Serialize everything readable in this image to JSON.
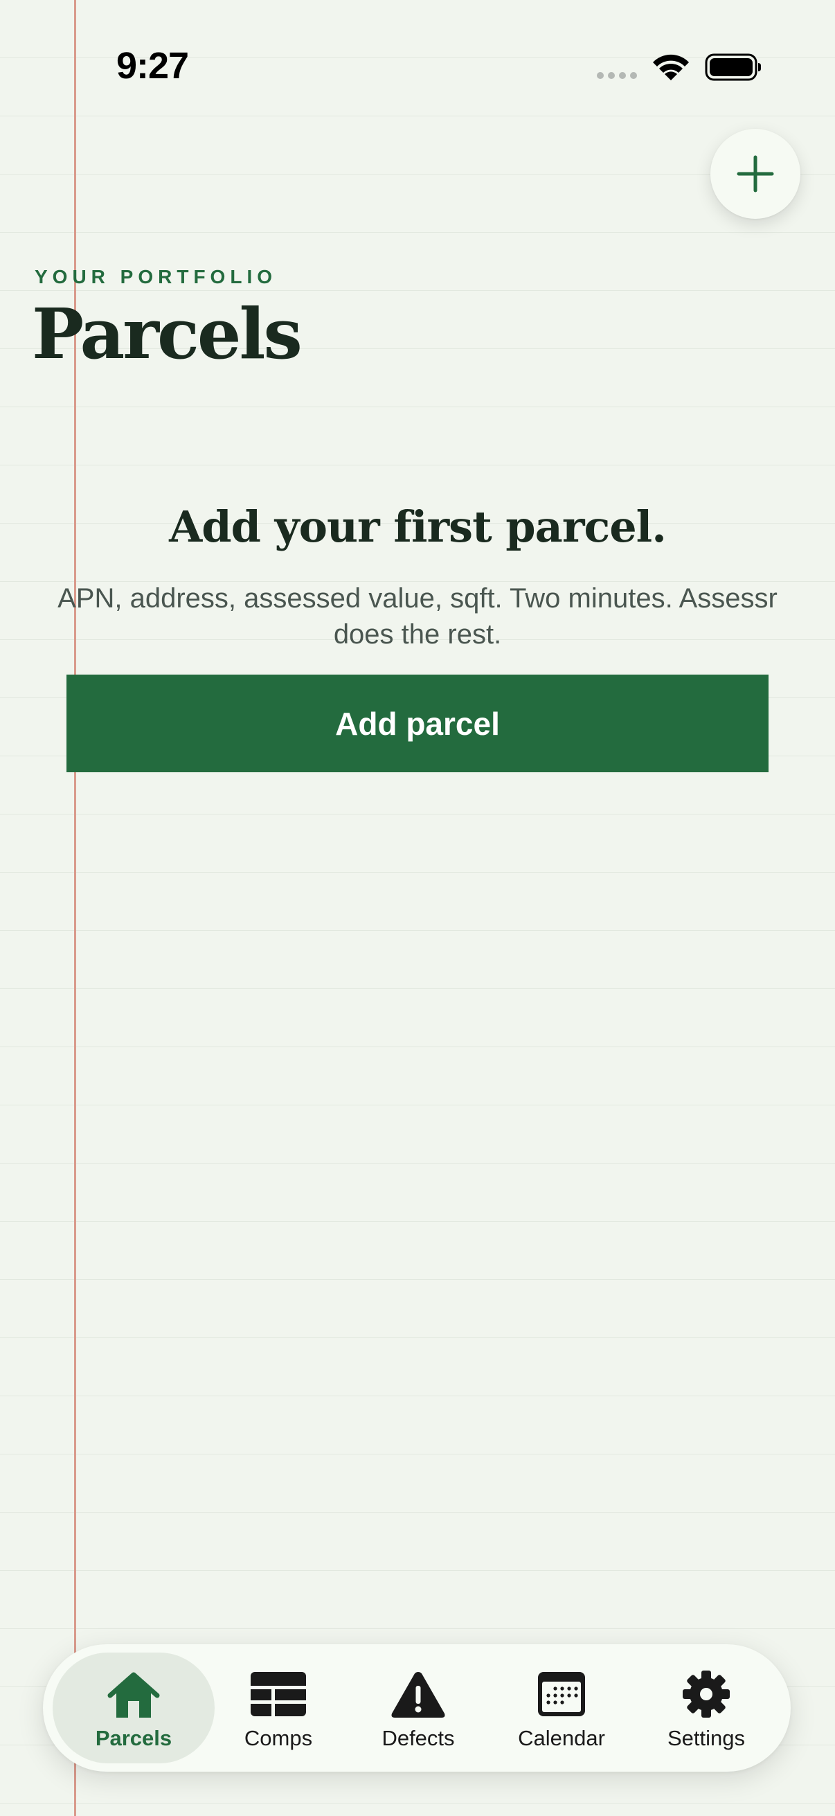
{
  "status_bar": {
    "time": "9:27"
  },
  "header": {
    "eyebrow": "YOUR PORTFOLIO",
    "title": "Parcels"
  },
  "empty_state": {
    "heading": "Add your first parcel.",
    "body": "APN, address, assessed value, sqft. Two minutes. Assessr does the rest.",
    "button_label": "Add parcel"
  },
  "fab": {
    "icon": "plus-icon"
  },
  "tab_bar": {
    "active": "Parcels",
    "items": [
      {
        "label": "Parcels",
        "icon": "house-icon"
      },
      {
        "label": "Comps",
        "icon": "table-icon"
      },
      {
        "label": "Defects",
        "icon": "warning-icon"
      },
      {
        "label": "Calendar",
        "icon": "calendar-icon"
      },
      {
        "label": "Settings",
        "icon": "gear-icon"
      }
    ]
  },
  "colors": {
    "background": "#f1f5ee",
    "accent": "#236b3e",
    "margin_line": "#d99a8c",
    "text": "#1a2a1f"
  }
}
